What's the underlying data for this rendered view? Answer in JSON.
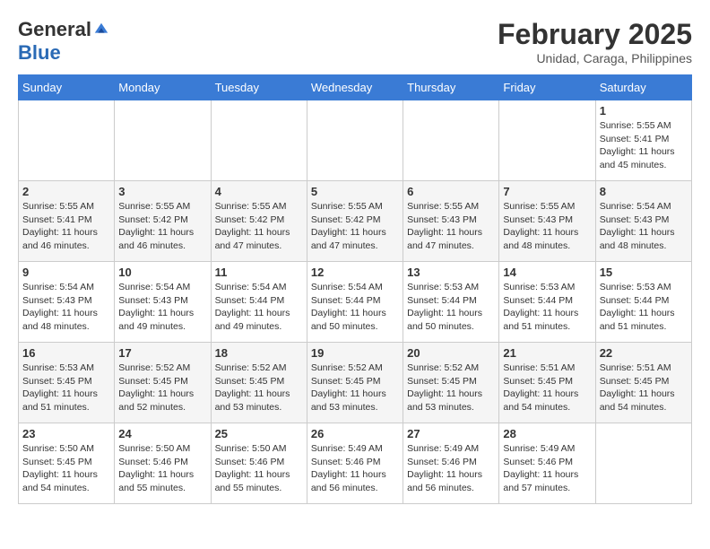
{
  "logo": {
    "general": "General",
    "blue": "Blue"
  },
  "title": {
    "month_year": "February 2025",
    "location": "Unidad, Caraga, Philippines"
  },
  "headers": [
    "Sunday",
    "Monday",
    "Tuesday",
    "Wednesday",
    "Thursday",
    "Friday",
    "Saturday"
  ],
  "weeks": [
    [
      {
        "day": "",
        "info": ""
      },
      {
        "day": "",
        "info": ""
      },
      {
        "day": "",
        "info": ""
      },
      {
        "day": "",
        "info": ""
      },
      {
        "day": "",
        "info": ""
      },
      {
        "day": "",
        "info": ""
      },
      {
        "day": "1",
        "info": "Sunrise: 5:55 AM\nSunset: 5:41 PM\nDaylight: 11 hours\nand 45 minutes."
      }
    ],
    [
      {
        "day": "2",
        "info": "Sunrise: 5:55 AM\nSunset: 5:41 PM\nDaylight: 11 hours\nand 46 minutes."
      },
      {
        "day": "3",
        "info": "Sunrise: 5:55 AM\nSunset: 5:42 PM\nDaylight: 11 hours\nand 46 minutes."
      },
      {
        "day": "4",
        "info": "Sunrise: 5:55 AM\nSunset: 5:42 PM\nDaylight: 11 hours\nand 47 minutes."
      },
      {
        "day": "5",
        "info": "Sunrise: 5:55 AM\nSunset: 5:42 PM\nDaylight: 11 hours\nand 47 minutes."
      },
      {
        "day": "6",
        "info": "Sunrise: 5:55 AM\nSunset: 5:43 PM\nDaylight: 11 hours\nand 47 minutes."
      },
      {
        "day": "7",
        "info": "Sunrise: 5:55 AM\nSunset: 5:43 PM\nDaylight: 11 hours\nand 48 minutes."
      },
      {
        "day": "8",
        "info": "Sunrise: 5:54 AM\nSunset: 5:43 PM\nDaylight: 11 hours\nand 48 minutes."
      }
    ],
    [
      {
        "day": "9",
        "info": "Sunrise: 5:54 AM\nSunset: 5:43 PM\nDaylight: 11 hours\nand 48 minutes."
      },
      {
        "day": "10",
        "info": "Sunrise: 5:54 AM\nSunset: 5:43 PM\nDaylight: 11 hours\nand 49 minutes."
      },
      {
        "day": "11",
        "info": "Sunrise: 5:54 AM\nSunset: 5:44 PM\nDaylight: 11 hours\nand 49 minutes."
      },
      {
        "day": "12",
        "info": "Sunrise: 5:54 AM\nSunset: 5:44 PM\nDaylight: 11 hours\nand 50 minutes."
      },
      {
        "day": "13",
        "info": "Sunrise: 5:53 AM\nSunset: 5:44 PM\nDaylight: 11 hours\nand 50 minutes."
      },
      {
        "day": "14",
        "info": "Sunrise: 5:53 AM\nSunset: 5:44 PM\nDaylight: 11 hours\nand 51 minutes."
      },
      {
        "day": "15",
        "info": "Sunrise: 5:53 AM\nSunset: 5:44 PM\nDaylight: 11 hours\nand 51 minutes."
      }
    ],
    [
      {
        "day": "16",
        "info": "Sunrise: 5:53 AM\nSunset: 5:45 PM\nDaylight: 11 hours\nand 51 minutes."
      },
      {
        "day": "17",
        "info": "Sunrise: 5:52 AM\nSunset: 5:45 PM\nDaylight: 11 hours\nand 52 minutes."
      },
      {
        "day": "18",
        "info": "Sunrise: 5:52 AM\nSunset: 5:45 PM\nDaylight: 11 hours\nand 53 minutes."
      },
      {
        "day": "19",
        "info": "Sunrise: 5:52 AM\nSunset: 5:45 PM\nDaylight: 11 hours\nand 53 minutes."
      },
      {
        "day": "20",
        "info": "Sunrise: 5:52 AM\nSunset: 5:45 PM\nDaylight: 11 hours\nand 53 minutes."
      },
      {
        "day": "21",
        "info": "Sunrise: 5:51 AM\nSunset: 5:45 PM\nDaylight: 11 hours\nand 54 minutes."
      },
      {
        "day": "22",
        "info": "Sunrise: 5:51 AM\nSunset: 5:45 PM\nDaylight: 11 hours\nand 54 minutes."
      }
    ],
    [
      {
        "day": "23",
        "info": "Sunrise: 5:50 AM\nSunset: 5:45 PM\nDaylight: 11 hours\nand 54 minutes."
      },
      {
        "day": "24",
        "info": "Sunrise: 5:50 AM\nSunset: 5:46 PM\nDaylight: 11 hours\nand 55 minutes."
      },
      {
        "day": "25",
        "info": "Sunrise: 5:50 AM\nSunset: 5:46 PM\nDaylight: 11 hours\nand 55 minutes."
      },
      {
        "day": "26",
        "info": "Sunrise: 5:49 AM\nSunset: 5:46 PM\nDaylight: 11 hours\nand 56 minutes."
      },
      {
        "day": "27",
        "info": "Sunrise: 5:49 AM\nSunset: 5:46 PM\nDaylight: 11 hours\nand 56 minutes."
      },
      {
        "day": "28",
        "info": "Sunrise: 5:49 AM\nSunset: 5:46 PM\nDaylight: 11 hours\nand 57 minutes."
      },
      {
        "day": "",
        "info": ""
      }
    ]
  ]
}
